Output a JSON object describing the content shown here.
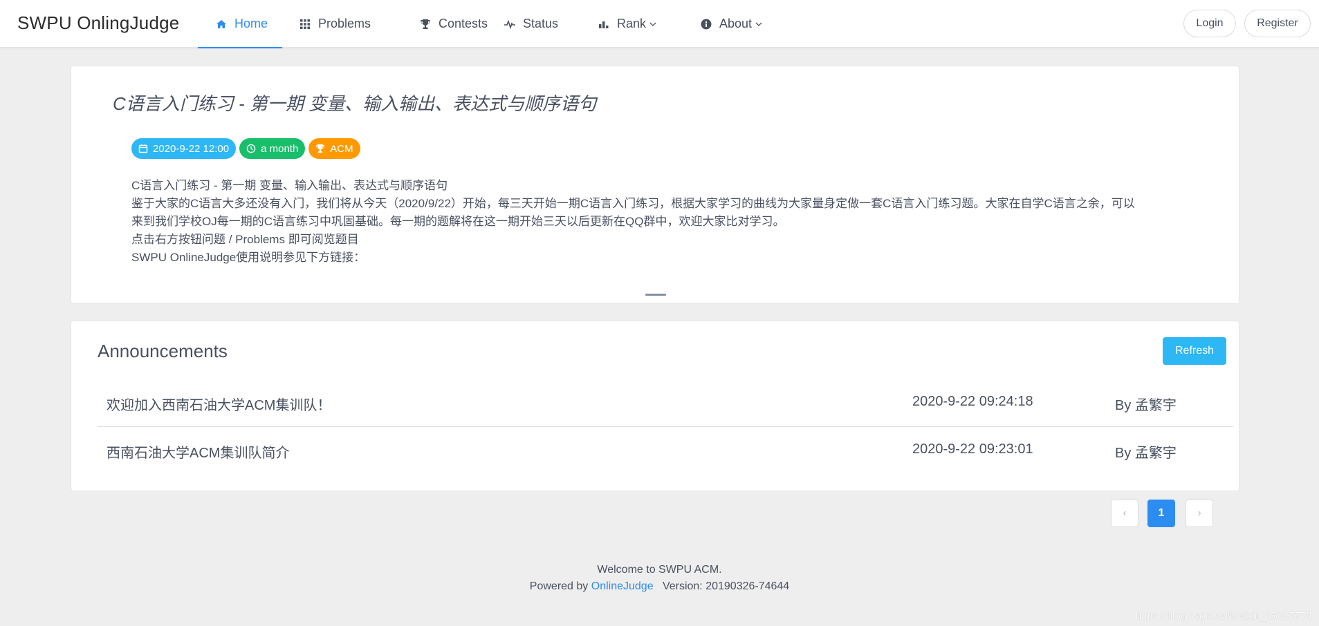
{
  "header": {
    "logo": "SWPU OnlingJudge",
    "nav": [
      {
        "label": "Home",
        "icon": "home-icon"
      },
      {
        "label": "Problems",
        "icon": "grid-icon"
      },
      {
        "label": "Contests",
        "icon": "trophy-icon"
      },
      {
        "label": "Status",
        "icon": "pulse-icon"
      },
      {
        "label": "Rank",
        "icon": "bar-chart-icon"
      },
      {
        "label": "About",
        "icon": "info-icon"
      }
    ],
    "login": "Login",
    "register": "Register"
  },
  "contest": {
    "title": "C语言入门练习 - 第一期 变量、输入输出、表达式与顺序语句",
    "start_time": "2020-9-22 12:00",
    "duration": "a month",
    "rule": "ACM",
    "description": [
      "C语言入门练习 - 第一期  变量、输入输出、表达式与顺序语句",
      "鉴于大家的C语言大多还没有入门，我们将从今天（2020/9/22）开始，每三天开始一期C语言入门练习，根据大家学习的曲线为大家量身定做一套C语言入门练习题。大家在自学C语言之余，可以",
      "来到我们学校OJ每一期的C语言练习中巩固基础。每一期的题解将在这一期开始三天以后更新在QQ群中，欢迎大家比对学习。",
      "点击右方按钮问题 / Problems 即可阅览题目",
      "SWPU OnlineJudge使用说明参见下方链接："
    ]
  },
  "announcements": {
    "title": "Announcements",
    "refresh": "Refresh",
    "items": [
      {
        "title": "欢迎加入西南石油大学ACM集训队！",
        "date": "2020-9-22 09:24:18",
        "author": "By 孟繁宇"
      },
      {
        "title": "西南石油大学ACM集训队简介",
        "date": "2020-9-22 09:23:01",
        "author": "By 孟繁宇"
      }
    ]
  },
  "pagination": {
    "prev": "‹",
    "current": "1",
    "next": "›"
  },
  "footer": {
    "welcome": "Welcome to SWPU ACM.",
    "powered_by": "Powered by",
    "link": "OnlineJudge",
    "version": "Version: 20190326-74644"
  },
  "watermark": "https://blog.csdn.net/weixin_45697774",
  "colors": {
    "accent": "#2d8cf0",
    "info": "#2db7f5",
    "success": "#19be6b",
    "warning": "#ff9900"
  }
}
